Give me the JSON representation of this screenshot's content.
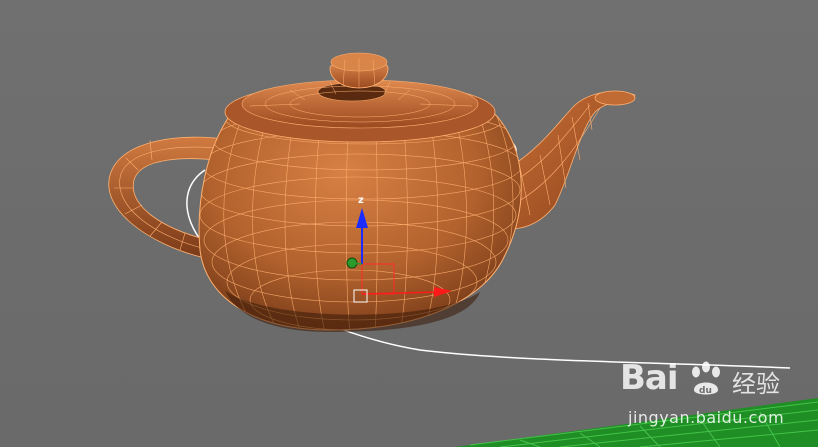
{
  "viewport": {
    "name": "3D perspective viewport",
    "background_color": "#6e6e6e",
    "object": "teapot",
    "object_color": "#b8642c",
    "wireframe_color": "#ffb070",
    "path_color": "#ffffff",
    "ground_grid_color": "#1fa02a"
  },
  "gizmo": {
    "z_label": "z",
    "z_color": "#1a2cff",
    "y_color": "#2a9a2a",
    "x_color": "#ff1a1a",
    "pivot_box_color": "#ffffff"
  },
  "watermark": {
    "brand_text_1": "Bai",
    "brand_text_2": "经验",
    "brand_text_du": "du",
    "url": "jingyan.baidu.com"
  }
}
